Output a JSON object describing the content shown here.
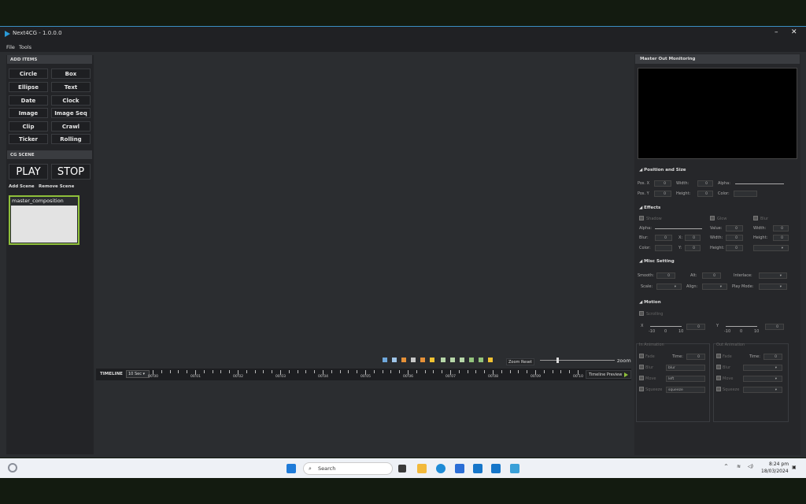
{
  "window": {
    "title": "Next4CG - 1.0.0.0",
    "minimize": "–",
    "close": "✕"
  },
  "menu": [
    "File",
    "Tools"
  ],
  "add_items": {
    "header": "ADD ITEMS",
    "buttons": [
      "Circle",
      "Box",
      "Ellipse",
      "Text",
      "Date",
      "Clock",
      "Image",
      "Image Seq",
      "Clip",
      "Crawl",
      "Ticker",
      "Rolling"
    ]
  },
  "cg_scene": {
    "header": "CG SCENE",
    "play": "PLAY",
    "stop": "STOP",
    "add_scene": "Add Scene",
    "remove_scene": "Remove Scene",
    "scene_name": "master_composition"
  },
  "canvas_toolbar": {
    "zoom_reset": "Zoom Reset",
    "zoom": "zoom",
    "zoom_level": 0.25
  },
  "timeline": {
    "label": "TIMELINE",
    "duration": "10 Sec",
    "ticks": [
      "00:00",
      "00:01",
      "00:02",
      "00:03",
      "00:04",
      "00:05",
      "00:06",
      "00:07",
      "00:08",
      "00:09",
      "00:10"
    ],
    "preview": "Timeline Preview"
  },
  "right": {
    "header": "Master Out Monitoring",
    "position_size": {
      "title": "Position and Size",
      "pos_x": "Pos. X",
      "pos_y": "Pos. Y",
      "width": "Width:",
      "height": "Height:",
      "alpha": "Alpha:",
      "color": "Color:",
      "zero": "0"
    },
    "effects": {
      "title": "Effects",
      "shadow": "Shadow",
      "glow": "Glow",
      "blur": "Blur",
      "alpha": "Alpha:",
      "blur_l": "Blur:",
      "x": "X:",
      "y": "Y:",
      "color": "Color:",
      "value": "Value:",
      "width": "Width:",
      "height": "Height:",
      "zero": "0"
    },
    "misc": {
      "title": "Misc Setting",
      "smooth": "Smooth:",
      "alt": "Alt:",
      "interlace": "Interlace:",
      "scale": "Scale:",
      "align": "Align:",
      "play_mode": "Play Mode:",
      "zero": "0"
    },
    "motion": {
      "title": "Motion",
      "scrolling": "Scrolling",
      "x": "X",
      "y": "Y",
      "scale": [
        "-10",
        "0",
        "10"
      ],
      "in_anim": "In Animation",
      "out_anim": "Out Animation",
      "fade": "Fade",
      "time": "Time:",
      "blur": "Blur",
      "move": "Move",
      "squeeze": "Squeeze",
      "blur_opt": "blur",
      "move_opt": "left",
      "squeeze_opt": "squeeze",
      "zero": "0"
    }
  },
  "taskbar": {
    "search": "Search",
    "time": "8:24 pm",
    "date": "18/03/2024",
    "icons": [
      "windows-icon",
      "search-icon",
      "task-view-icon",
      "file-explorer-icon",
      "edge-icon",
      "store-icon",
      "next4cg-icon",
      "next4cg-icon-2",
      "app-icon"
    ],
    "colors": {
      "accent": "#3b8ec2",
      "scene_border": "#8fbf3a"
    }
  }
}
